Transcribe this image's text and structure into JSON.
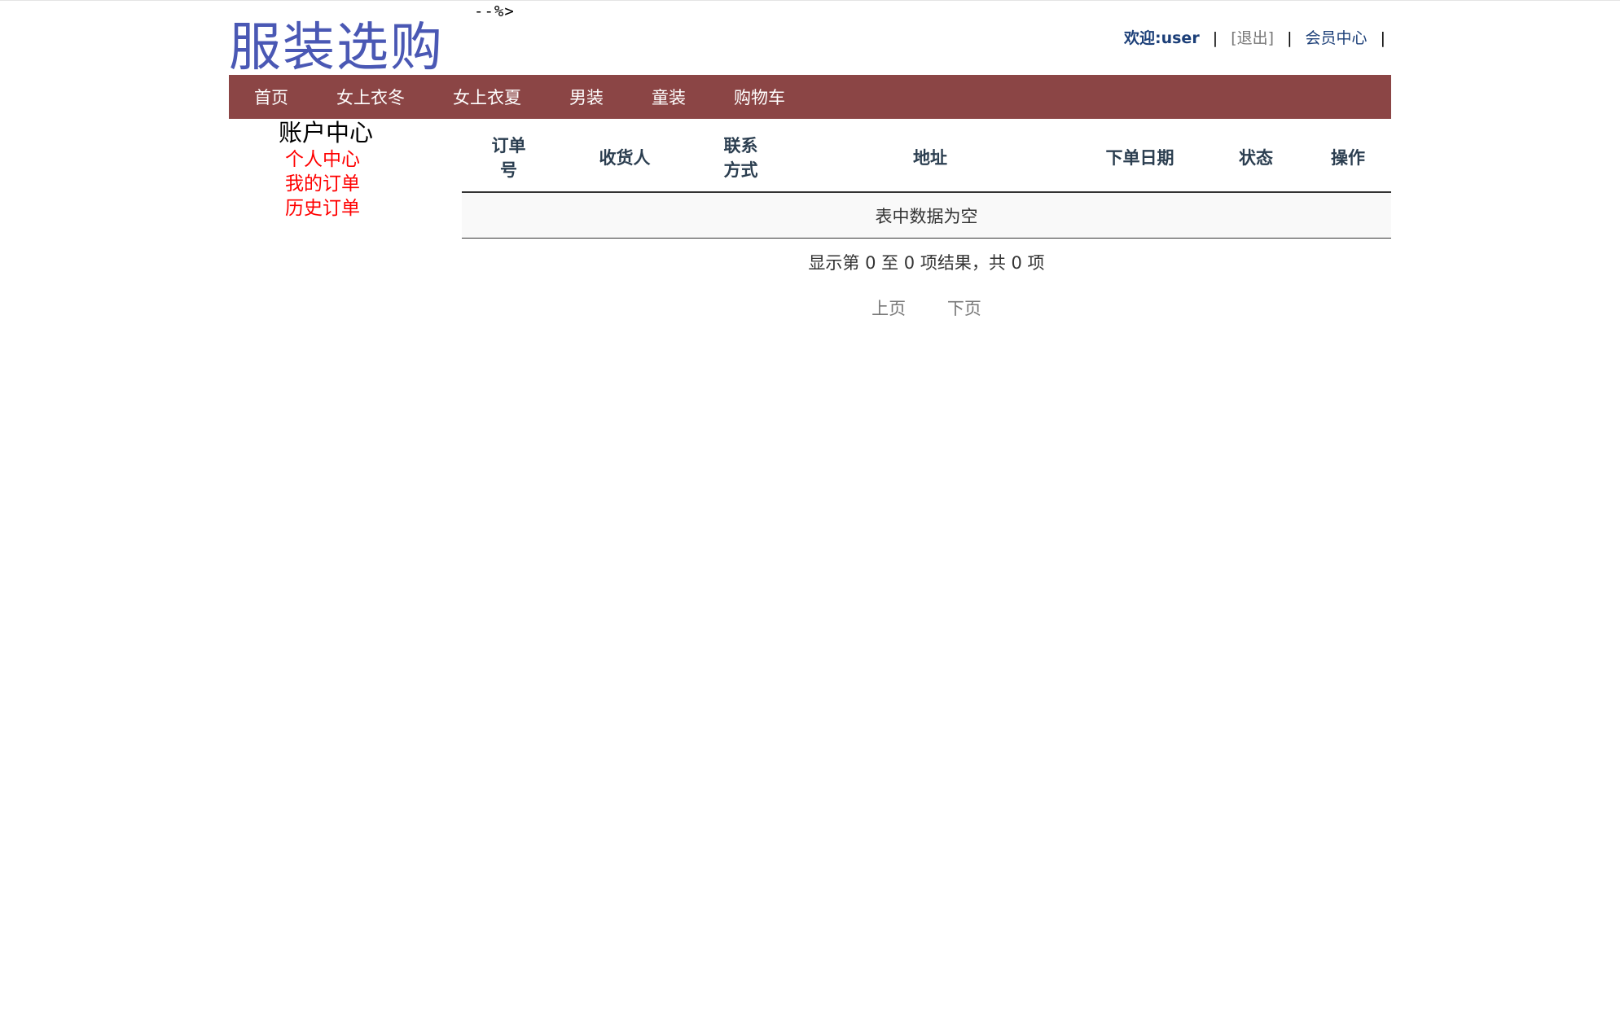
{
  "stray_text": "--%>",
  "logo": {
    "text": "服装选购"
  },
  "user_bar": {
    "welcome": "欢迎:user",
    "separator": "|",
    "logout": "[退出]",
    "member_center": "会员中心"
  },
  "nav": {
    "items": [
      {
        "label": "首页"
      },
      {
        "label": "女上衣冬"
      },
      {
        "label": "女上衣夏"
      },
      {
        "label": "男装"
      },
      {
        "label": "童装"
      },
      {
        "label": "购物车"
      }
    ]
  },
  "sidebar": {
    "title": "账户中心",
    "links": [
      {
        "label": "个人中心"
      },
      {
        "label": "我的订单"
      },
      {
        "label": "历史订单"
      }
    ]
  },
  "table": {
    "headers": [
      {
        "line1": "订单",
        "line2": "号"
      },
      {
        "line1": "收货人",
        "line2": ""
      },
      {
        "line1": "联系",
        "line2": "方式"
      },
      {
        "line1": "地址",
        "line2": ""
      },
      {
        "line1": "下单日期",
        "line2": ""
      },
      {
        "line1": "状态",
        "line2": ""
      },
      {
        "line1": "操作",
        "line2": ""
      }
    ],
    "empty_message": "表中数据为空",
    "info": "显示第 0 至 0 项结果，共 0 项"
  },
  "pager": {
    "prev": "上页",
    "next": "下页"
  },
  "colors": {
    "navbar": "#8b4545",
    "logo": "#4a58b4",
    "sidebar_links": "#ff0000",
    "header_text": "#2b3e50"
  }
}
